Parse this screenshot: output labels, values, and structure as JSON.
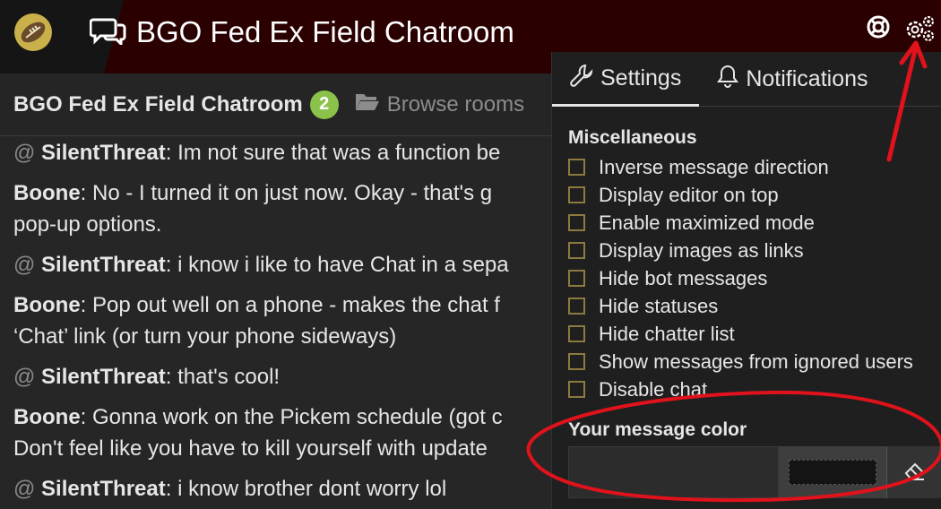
{
  "header": {
    "title": "BGO Fed Ex Field Chatroom",
    "logo_icon": "football-icon",
    "chat_icon": "comments-icon",
    "help_icon": "lifebuoy-icon",
    "settings_icon": "gears-icon"
  },
  "roombar": {
    "room_name": "BGO Fed Ex Field Chatroom",
    "count": "2",
    "browse_label": "Browse rooms"
  },
  "messages": [
    {
      "at": "@",
      "author": "SilentThreat",
      "text": ": Im not sure that was a function be"
    },
    {
      "at": "",
      "author": "Boone",
      "text": ": No - I turned it on just now. Okay - that's g",
      "text2": "pop-up options."
    },
    {
      "at": "@",
      "author": "SilentThreat",
      "text": ": i know i like to have Chat in a sepa"
    },
    {
      "at": "",
      "author": "Boone",
      "text": ": Pop out well on a phone - makes the chat f",
      "text2": "‘Chat’ link (or turn your phone sideways)"
    },
    {
      "at": "@",
      "author": "SilentThreat",
      "text": ": that's cool!"
    },
    {
      "at": "",
      "author": "Boone",
      "text": ": Gonna work on the Pickem schedule (got c",
      "text2": "Don't feel like you have to kill yourself with update"
    },
    {
      "at": "@",
      "author": "SilentThreat",
      "text": ": i know brother dont worry lol"
    }
  ],
  "panel": {
    "tab_settings": "Settings",
    "tab_notifications": "Notifications",
    "misc_title": "Miscellaneous",
    "options": [
      "Inverse message direction",
      "Display editor on top",
      "Enable maximized mode",
      "Display images as links",
      "Hide bot messages",
      "Hide statuses",
      "Hide chatter list",
      "Show messages from ignored users",
      "Disable chat"
    ],
    "color_title": "Your message color",
    "clear_icon": "eraser-icon"
  },
  "colors": {
    "header_bg": "#2a0000",
    "badge": "#8bc34a",
    "annotation": "#e0121b",
    "checkbox_border": "#8c7a40"
  }
}
